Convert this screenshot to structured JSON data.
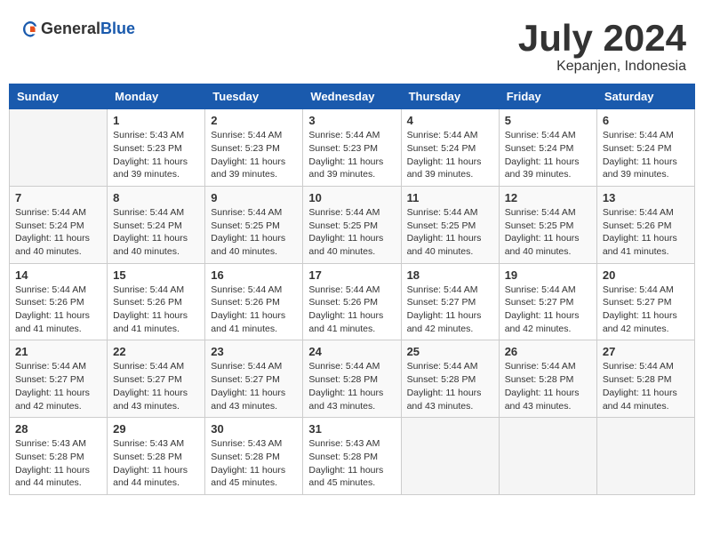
{
  "header": {
    "logo_general": "General",
    "logo_blue": "Blue",
    "month": "July 2024",
    "location": "Kepanjen, Indonesia"
  },
  "weekdays": [
    "Sunday",
    "Monday",
    "Tuesday",
    "Wednesday",
    "Thursday",
    "Friday",
    "Saturday"
  ],
  "weeks": [
    [
      null,
      {
        "day": 1,
        "sunrise": "5:43 AM",
        "sunset": "5:23 PM",
        "daylight": "11 hours and 39 minutes."
      },
      {
        "day": 2,
        "sunrise": "5:44 AM",
        "sunset": "5:23 PM",
        "daylight": "11 hours and 39 minutes."
      },
      {
        "day": 3,
        "sunrise": "5:44 AM",
        "sunset": "5:23 PM",
        "daylight": "11 hours and 39 minutes."
      },
      {
        "day": 4,
        "sunrise": "5:44 AM",
        "sunset": "5:24 PM",
        "daylight": "11 hours and 39 minutes."
      },
      {
        "day": 5,
        "sunrise": "5:44 AM",
        "sunset": "5:24 PM",
        "daylight": "11 hours and 39 minutes."
      },
      {
        "day": 6,
        "sunrise": "5:44 AM",
        "sunset": "5:24 PM",
        "daylight": "11 hours and 39 minutes."
      }
    ],
    [
      {
        "day": 7,
        "sunrise": "5:44 AM",
        "sunset": "5:24 PM",
        "daylight": "11 hours and 40 minutes."
      },
      {
        "day": 8,
        "sunrise": "5:44 AM",
        "sunset": "5:24 PM",
        "daylight": "11 hours and 40 minutes."
      },
      {
        "day": 9,
        "sunrise": "5:44 AM",
        "sunset": "5:25 PM",
        "daylight": "11 hours and 40 minutes."
      },
      {
        "day": 10,
        "sunrise": "5:44 AM",
        "sunset": "5:25 PM",
        "daylight": "11 hours and 40 minutes."
      },
      {
        "day": 11,
        "sunrise": "5:44 AM",
        "sunset": "5:25 PM",
        "daylight": "11 hours and 40 minutes."
      },
      {
        "day": 12,
        "sunrise": "5:44 AM",
        "sunset": "5:25 PM",
        "daylight": "11 hours and 40 minutes."
      },
      {
        "day": 13,
        "sunrise": "5:44 AM",
        "sunset": "5:26 PM",
        "daylight": "11 hours and 41 minutes."
      }
    ],
    [
      {
        "day": 14,
        "sunrise": "5:44 AM",
        "sunset": "5:26 PM",
        "daylight": "11 hours and 41 minutes."
      },
      {
        "day": 15,
        "sunrise": "5:44 AM",
        "sunset": "5:26 PM",
        "daylight": "11 hours and 41 minutes."
      },
      {
        "day": 16,
        "sunrise": "5:44 AM",
        "sunset": "5:26 PM",
        "daylight": "11 hours and 41 minutes."
      },
      {
        "day": 17,
        "sunrise": "5:44 AM",
        "sunset": "5:26 PM",
        "daylight": "11 hours and 41 minutes."
      },
      {
        "day": 18,
        "sunrise": "5:44 AM",
        "sunset": "5:27 PM",
        "daylight": "11 hours and 42 minutes."
      },
      {
        "day": 19,
        "sunrise": "5:44 AM",
        "sunset": "5:27 PM",
        "daylight": "11 hours and 42 minutes."
      },
      {
        "day": 20,
        "sunrise": "5:44 AM",
        "sunset": "5:27 PM",
        "daylight": "11 hours and 42 minutes."
      }
    ],
    [
      {
        "day": 21,
        "sunrise": "5:44 AM",
        "sunset": "5:27 PM",
        "daylight": "11 hours and 42 minutes."
      },
      {
        "day": 22,
        "sunrise": "5:44 AM",
        "sunset": "5:27 PM",
        "daylight": "11 hours and 43 minutes."
      },
      {
        "day": 23,
        "sunrise": "5:44 AM",
        "sunset": "5:27 PM",
        "daylight": "11 hours and 43 minutes."
      },
      {
        "day": 24,
        "sunrise": "5:44 AM",
        "sunset": "5:28 PM",
        "daylight": "11 hours and 43 minutes."
      },
      {
        "day": 25,
        "sunrise": "5:44 AM",
        "sunset": "5:28 PM",
        "daylight": "11 hours and 43 minutes."
      },
      {
        "day": 26,
        "sunrise": "5:44 AM",
        "sunset": "5:28 PM",
        "daylight": "11 hours and 43 minutes."
      },
      {
        "day": 27,
        "sunrise": "5:44 AM",
        "sunset": "5:28 PM",
        "daylight": "11 hours and 44 minutes."
      }
    ],
    [
      {
        "day": 28,
        "sunrise": "5:43 AM",
        "sunset": "5:28 PM",
        "daylight": "11 hours and 44 minutes."
      },
      {
        "day": 29,
        "sunrise": "5:43 AM",
        "sunset": "5:28 PM",
        "daylight": "11 hours and 44 minutes."
      },
      {
        "day": 30,
        "sunrise": "5:43 AM",
        "sunset": "5:28 PM",
        "daylight": "11 hours and 45 minutes."
      },
      {
        "day": 31,
        "sunrise": "5:43 AM",
        "sunset": "5:28 PM",
        "daylight": "11 hours and 45 minutes."
      },
      null,
      null,
      null
    ]
  ]
}
